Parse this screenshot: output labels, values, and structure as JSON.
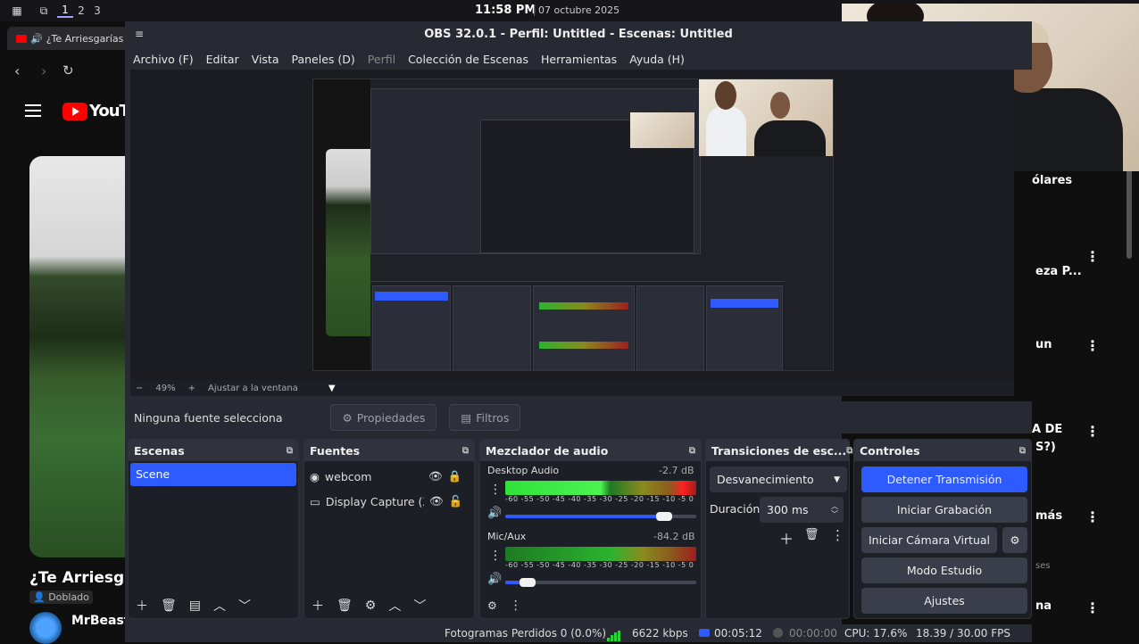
{
  "system_bar": {
    "workspaces": [
      "1",
      "2",
      "3"
    ],
    "active_workspace": "1",
    "time": "11:58 PM",
    "date": "07 octubre 2025"
  },
  "browser": {
    "tab_title": "¿Te Arriesgarías",
    "youtube_logo_text": "YouTube",
    "video_title": "¿Te Arriesga",
    "badge": "Doblado",
    "channel_name": "MrBeast",
    "right_list_texts": [
      "ólares",
      "eza P...",
      "un",
      "A DE",
      "S?)",
      "más",
      "ses",
      "na"
    ]
  },
  "obs": {
    "window_title": "OBS 32.0.1 - Perfil: Untitled - Escenas: Untitled",
    "menu": {
      "archivo": "Archivo (F)",
      "editar": "Editar",
      "vista": "Vista",
      "paneles": "Paneles (D)",
      "perfil": "Perfil",
      "coleccion": "Colección de Escenas",
      "herramientas": "Herramientas",
      "ayuda": "Ayuda (H)"
    },
    "zoom": {
      "minus": "−",
      "value": "49%",
      "plus": "+",
      "fit": "Ajustar a la ventana"
    },
    "source_toolbar": {
      "no_source": "Ninguna fuente selecciona",
      "properties": "Propiedades",
      "filters": "Filtros"
    },
    "scenes": {
      "title": "Escenas",
      "items": [
        "Scene"
      ]
    },
    "sources": {
      "title": "Fuentes",
      "items": [
        {
          "name": "webcom",
          "icon": "webcam-icon"
        },
        {
          "name": "Display Capture (X",
          "icon": "monitor-icon"
        }
      ]
    },
    "mixer": {
      "title": "Mezclador de audio",
      "channels": [
        {
          "name": "Desktop Audio",
          "db": "-2.7 dB",
          "volume": 0.86
        },
        {
          "name": "Mic/Aux",
          "db": "-84.2 dB",
          "volume": 0.08
        }
      ],
      "ticks": "-60 -55 -50 -45 -40 -35 -30 -25 -20 -15 -10 -5 0"
    },
    "transitions": {
      "title": "Transiciones de esc...",
      "selected": "Desvanecimiento",
      "duration_label": "Duración",
      "duration_value": "300 ms"
    },
    "controls": {
      "title": "Controles",
      "stop_stream": "Detener Transmisión",
      "start_recording": "Iniciar Grabación",
      "start_virtual_cam": "Iniciar Cámara Virtual",
      "studio_mode": "Modo Estudio",
      "settings": "Ajustes"
    },
    "status": {
      "dropped_frames": "Fotogramas Perdidos 0 (0.0%)",
      "bitrate": "6622 kbps",
      "stream_time": "00:05:12",
      "record_time": "00:00:00",
      "cpu": "CPU: 17.6%",
      "fps": "18.39 / 30.00 FPS"
    }
  },
  "colors": {
    "accent": "#2e5bff",
    "panel_bg": "#1d1f26",
    "window_bg": "#272a33",
    "youtube_red": "#ff0000"
  }
}
